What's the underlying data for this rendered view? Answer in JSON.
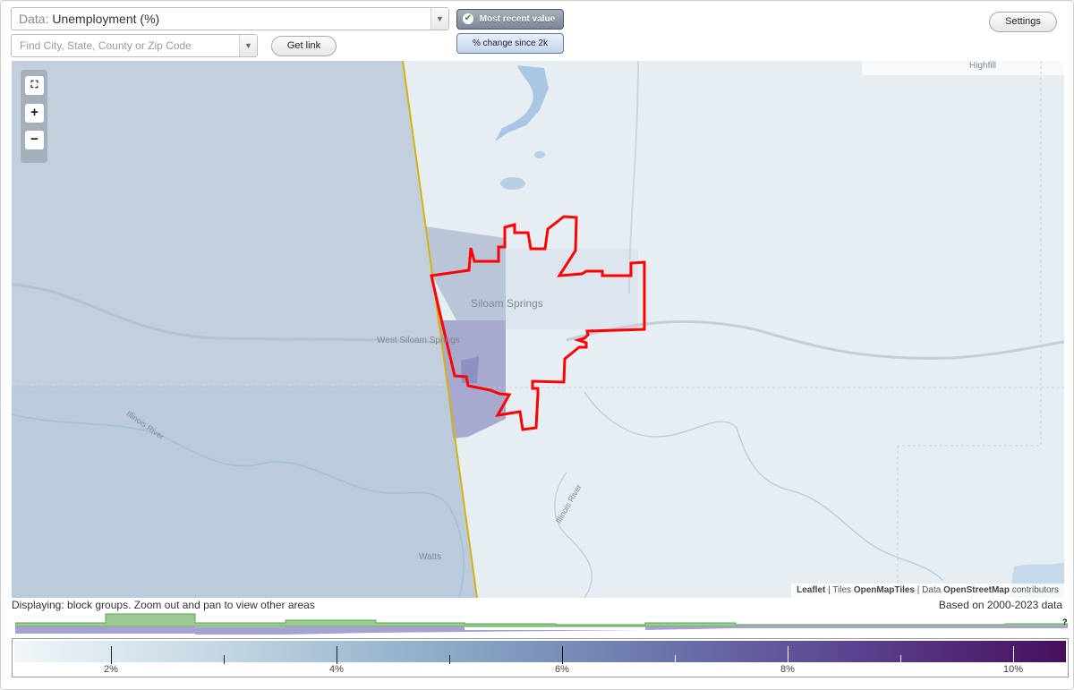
{
  "top_controls": {
    "data_select": {
      "label": "Data:",
      "value": "Unemployment (%)"
    },
    "search": {
      "placeholder": "Find City, State, County or Zip Code"
    },
    "get_link_label": "Get link",
    "mode_buttons": {
      "recent": "Most recent value",
      "change": "% change since 2k"
    },
    "settings_label": "Settings"
  },
  "map": {
    "zoom_controls": {
      "fit": "fit-screen",
      "zoom_in": "+",
      "zoom_out": "−"
    },
    "labels": {
      "city": "Siloam Springs",
      "west_city": "West Siloam Springs",
      "watts": "Watts",
      "highfill": "Highfill",
      "river_west": "Illinois River",
      "river_east": "Illinois River"
    },
    "attribution": {
      "leaflet": "Leaflet",
      "tiles_prefix": "| Tiles",
      "tiles": "OpenMapTiles",
      "data_prefix": "| Data",
      "osm": "OpenStreetMap",
      "osm_suffix": "contributors"
    },
    "colors": {
      "highlight_outline": "#ff0000",
      "state_border": "#d4b20f",
      "west_shade": "#a9bed2",
      "purple_block": "#8f8fc4"
    }
  },
  "footer": {
    "displaying": "Displaying: block groups. Zoom out and pan to view other areas",
    "based_on": "Based on 2000-2023 data",
    "histogram_help": "?",
    "legend": {
      "tick_labels": [
        "2%",
        "4%",
        "6%",
        "8%",
        "10%"
      ],
      "gradient": [
        "#f1f6f9",
        "#c3d6e2",
        "#8eadc9",
        "#6d79ad",
        "#5a4290",
        "#470f5c"
      ]
    }
  }
}
